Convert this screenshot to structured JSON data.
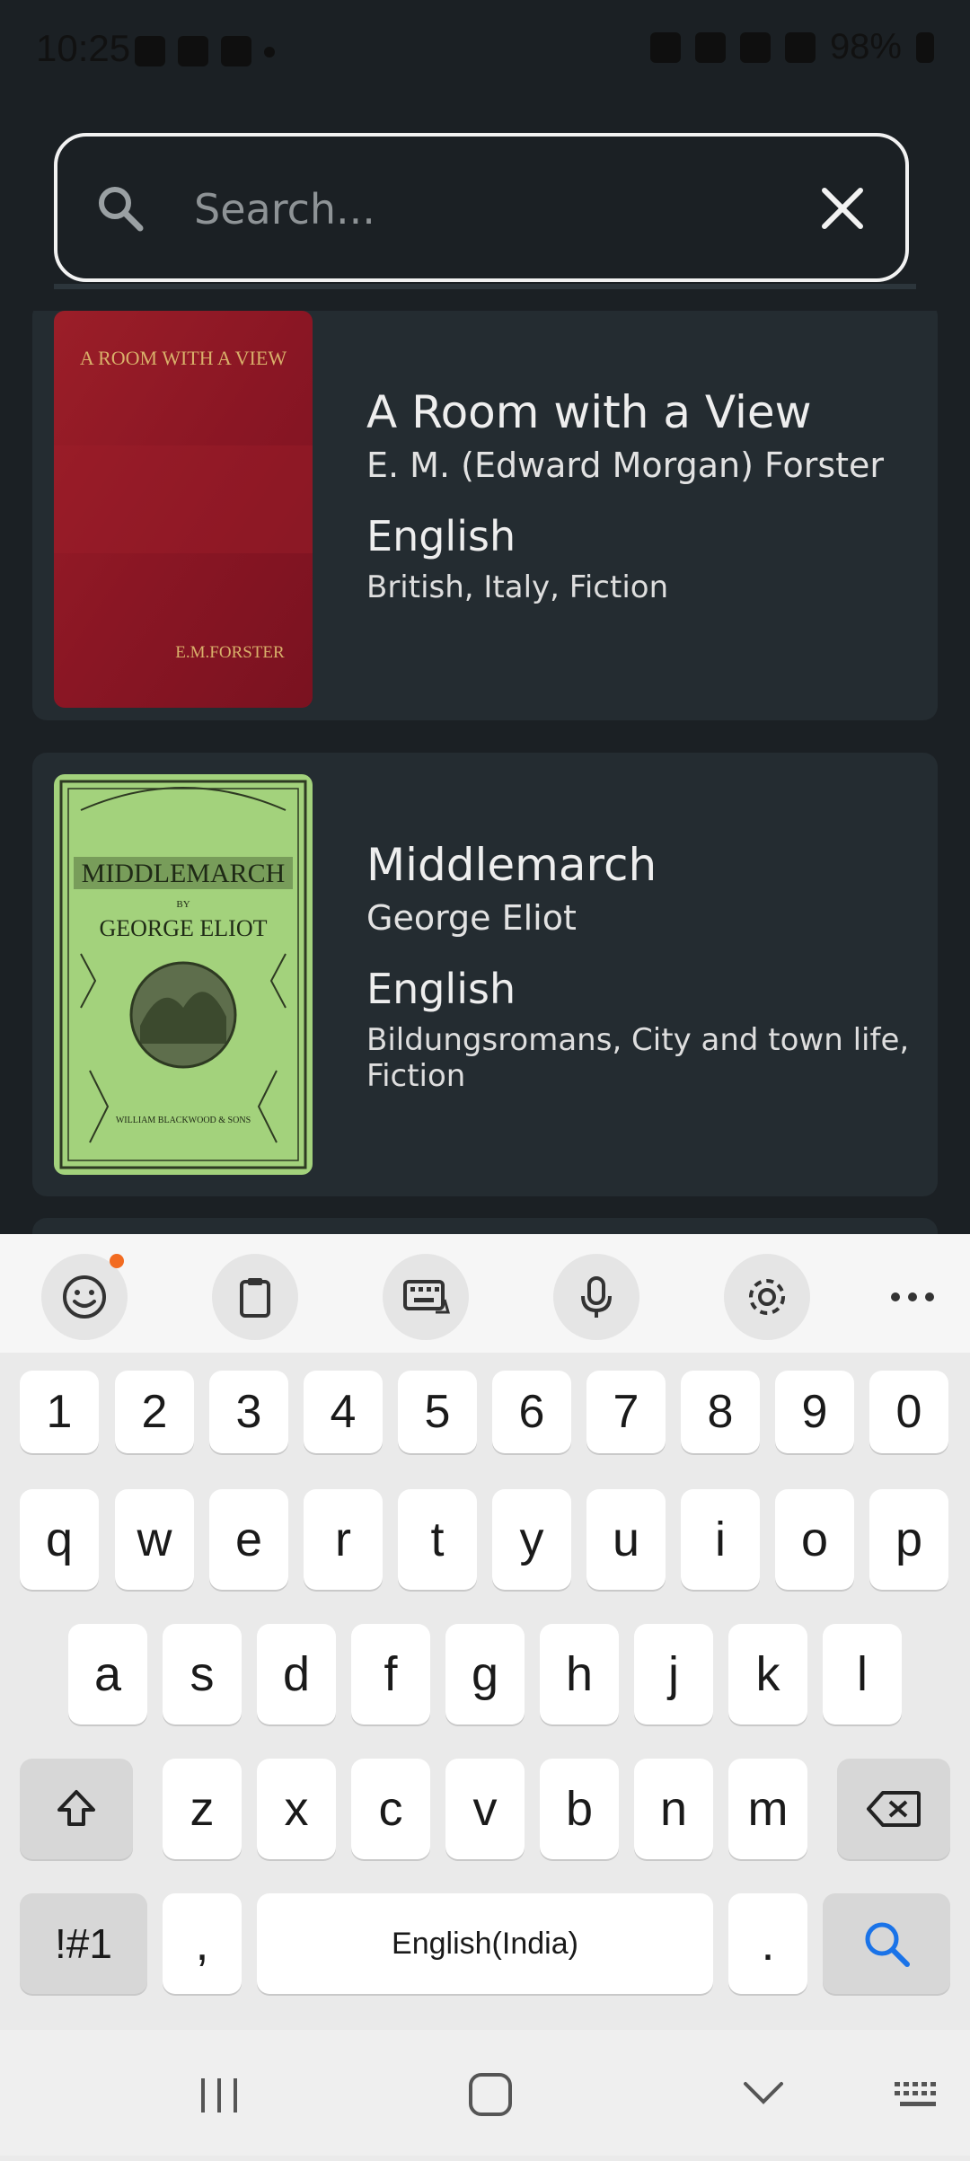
{
  "status_bar": {
    "time": "10:25",
    "battery": "98%"
  },
  "search": {
    "placeholder": "Search..."
  },
  "books": [
    {
      "title": "A Room with a View",
      "author": "E. M. (Edward Morgan) Forster",
      "language": "English",
      "subjects": "British, Italy, Fiction",
      "cover_title": "A ROOM WITH A VIEW",
      "cover_author": "E.M.FORSTER",
      "cover_color": "#8a1a25"
    },
    {
      "title": "Middlemarch",
      "author": "George Eliot",
      "language": "English",
      "subjects": "Bildungsromans, City and town life, Fiction",
      "cover_title": "MIDDLEMARCH",
      "cover_by": "BY",
      "cover_author": "GEORGE ELIOT",
      "cover_publisher": "WILLIAM BLACKWOOD & SONS",
      "cover_color": "#9ecf78"
    }
  ],
  "keyboard": {
    "toolbar": [
      "emoji-icon",
      "clipboard-icon",
      "keyboard-mode-icon",
      "mic-icon",
      "settings-icon",
      "more-icon"
    ],
    "row_numbers": [
      "1",
      "2",
      "3",
      "4",
      "5",
      "6",
      "7",
      "8",
      "9",
      "0"
    ],
    "row1": [
      "q",
      "w",
      "e",
      "r",
      "t",
      "y",
      "u",
      "i",
      "o",
      "p"
    ],
    "row2": [
      "a",
      "s",
      "d",
      "f",
      "g",
      "h",
      "j",
      "k",
      "l"
    ],
    "row3": [
      "z",
      "x",
      "c",
      "v",
      "b",
      "n",
      "m"
    ],
    "symbols_label": "!#1",
    "comma": ",",
    "space_label": "English(India)",
    "period": "."
  }
}
